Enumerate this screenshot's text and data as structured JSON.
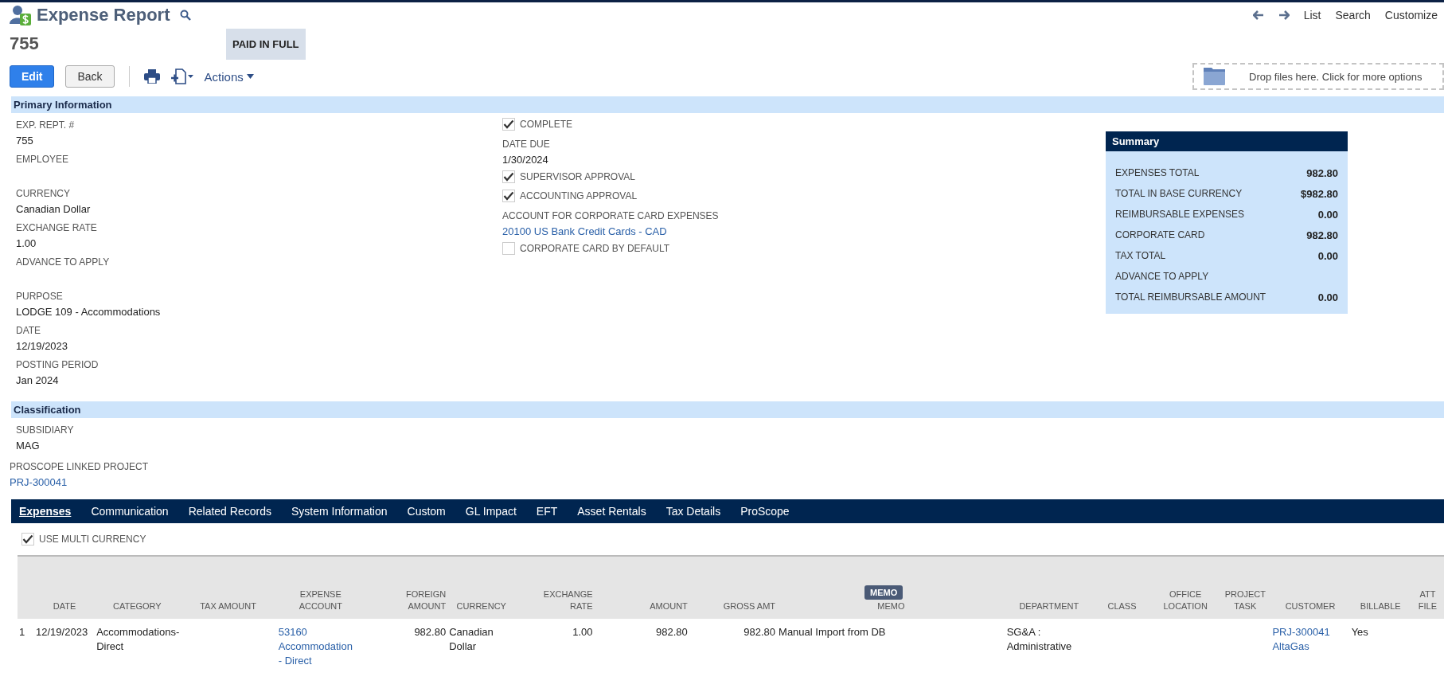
{
  "header": {
    "title": "Expense Report",
    "record_number": "755",
    "status": "PAID IN FULL",
    "nav": [
      "List",
      "Search",
      "Customize"
    ]
  },
  "toolbar": {
    "buttons": [
      {
        "label": "Edit",
        "kind": "primary"
      },
      {
        "label": "Back",
        "kind": "secondary"
      }
    ],
    "actions": "Actions",
    "dropzone": "Drop files here. Click for more options"
  },
  "primary": {
    "title": "Primary Information",
    "left_fields": [
      {
        "label": "EXP. REPT. #",
        "value": "755"
      },
      {
        "label": "EMPLOYEE"
      },
      {
        "label": "CURRENCY",
        "value": "Canadian Dollar"
      },
      {
        "label": "EXCHANGE RATE",
        "value": "1.00"
      },
      {
        "label": "ADVANCE TO APPLY"
      },
      {
        "label": "PURPOSE",
        "value": "LODGE 109 - Accommodations"
      },
      {
        "label": "DATE",
        "value": "12/19/2023"
      },
      {
        "label": "POSTING PERIOD",
        "value": "Jan 2024"
      }
    ],
    "right_fields": [
      {
        "kind": "checkbox",
        "label": "COMPLETE",
        "checked": true
      },
      {
        "kind": "text",
        "label": "DATE DUE",
        "value": "1/30/2024"
      },
      {
        "kind": "checkbox",
        "label": "SUPERVISOR APPROVAL",
        "checked": true
      },
      {
        "kind": "checkbox",
        "label": "ACCOUNTING APPROVAL",
        "checked": true
      },
      {
        "kind": "link",
        "label": "ACCOUNT FOR CORPORATE CARD EXPENSES",
        "value": "20100 US Bank Credit Cards - CAD"
      },
      {
        "kind": "checkbox",
        "label": "CORPORATE CARD BY DEFAULT",
        "checked": false
      }
    ]
  },
  "summary": {
    "title": "Summary",
    "rows": [
      {
        "label": "EXPENSES TOTAL",
        "value": "982.80"
      },
      {
        "label": "TOTAL IN BASE CURRENCY",
        "value": "$982.80"
      },
      {
        "label": "REIMBURSABLE EXPENSES",
        "value": "0.00"
      },
      {
        "label": "CORPORATE CARD",
        "value": "982.80"
      },
      {
        "label": "TAX TOTAL",
        "value": "0.00"
      },
      {
        "label": "ADVANCE TO APPLY"
      },
      {
        "label": "TOTAL REIMBURSABLE AMOUNT",
        "value": "0.00"
      }
    ]
  },
  "classification": {
    "title": "Classification",
    "fields": [
      {
        "label": "SUBSIDIARY",
        "value": "MAG",
        "kind": "text"
      },
      {
        "label": "PROSCOPE LINKED PROJECT",
        "value": "PRJ-300041",
        "kind": "link"
      }
    ]
  },
  "tabs": [
    {
      "label": "Expenses",
      "selected": true
    },
    {
      "label": "Communication",
      "selected": false
    },
    {
      "label": "Related Records",
      "selected": false
    },
    {
      "label": "System Information",
      "selected": false
    },
    {
      "label": "Custom",
      "selected": false
    },
    {
      "label": "GL Impact",
      "selected": false
    },
    {
      "label": "EFT",
      "selected": false
    },
    {
      "label": "Asset Rentals",
      "selected": false
    },
    {
      "label": "Tax Details",
      "selected": false
    },
    {
      "label": "ProScope",
      "selected": false
    }
  ],
  "multi_currency": {
    "label": "USE MULTI CURRENCY",
    "checked": true
  },
  "table": {
    "columns": [
      {
        "kind": "index"
      },
      {
        "label": "DATE",
        "kind": "text"
      },
      {
        "label": "CATEGORY",
        "kind": "text"
      },
      {
        "label": "TAX AMOUNT",
        "kind": "text"
      },
      {
        "label": "EXPENSE\nACCOUNT",
        "kind": "text"
      },
      {
        "label": "FOREIGN\nAMOUNT",
        "kind": "number"
      },
      {
        "label": "CURRENCY",
        "kind": "text"
      },
      {
        "label": "EXCHANGE\nRATE",
        "kind": "number"
      },
      {
        "label": "AMOUNT",
        "kind": "number"
      },
      {
        "label": "GROSS AMT",
        "kind": "number"
      },
      {
        "label": "MEMO",
        "kind": "text"
      },
      {
        "label": "DEPARTMENT",
        "kind": "text"
      },
      {
        "label": "CLASS",
        "kind": "text"
      },
      {
        "label": "OFFICE\nLOCATION",
        "kind": "text"
      },
      {
        "label": "PROJECT\nTASK",
        "kind": "text"
      },
      {
        "label": "CUSTOMER",
        "kind": "text"
      },
      {
        "label": "BILLABLE",
        "kind": "text"
      },
      {
        "label": "ATT\nFILE",
        "kind": "text"
      }
    ],
    "tooltip": "MEMO",
    "rows": [
      {
        "cells": [
          {
            "text": "1",
            "kind": "text"
          },
          {
            "text": "12/19/2023",
            "kind": "text"
          },
          {
            "text": "Accommodations-\nDirect",
            "kind": "text"
          },
          {},
          {
            "text": "53160\nAccommodation\n- Direct",
            "kind": "link"
          },
          {
            "text": "982.80",
            "kind": "text"
          },
          {
            "text": "Canadian\nDollar",
            "kind": "text"
          },
          {
            "text": "1.00",
            "kind": "text"
          },
          {
            "text": "982.80",
            "kind": "text"
          },
          {
            "text": "982.80",
            "kind": "text"
          },
          {
            "text": "Manual Import from DB",
            "kind": "text"
          },
          {
            "text": "SG&A :\nAdministrative",
            "kind": "text"
          },
          {},
          {},
          {},
          {
            "text": "PRJ-300041\nAltaGas",
            "kind": "link"
          },
          {
            "text": "Yes",
            "kind": "text"
          },
          {}
        ]
      }
    ]
  }
}
